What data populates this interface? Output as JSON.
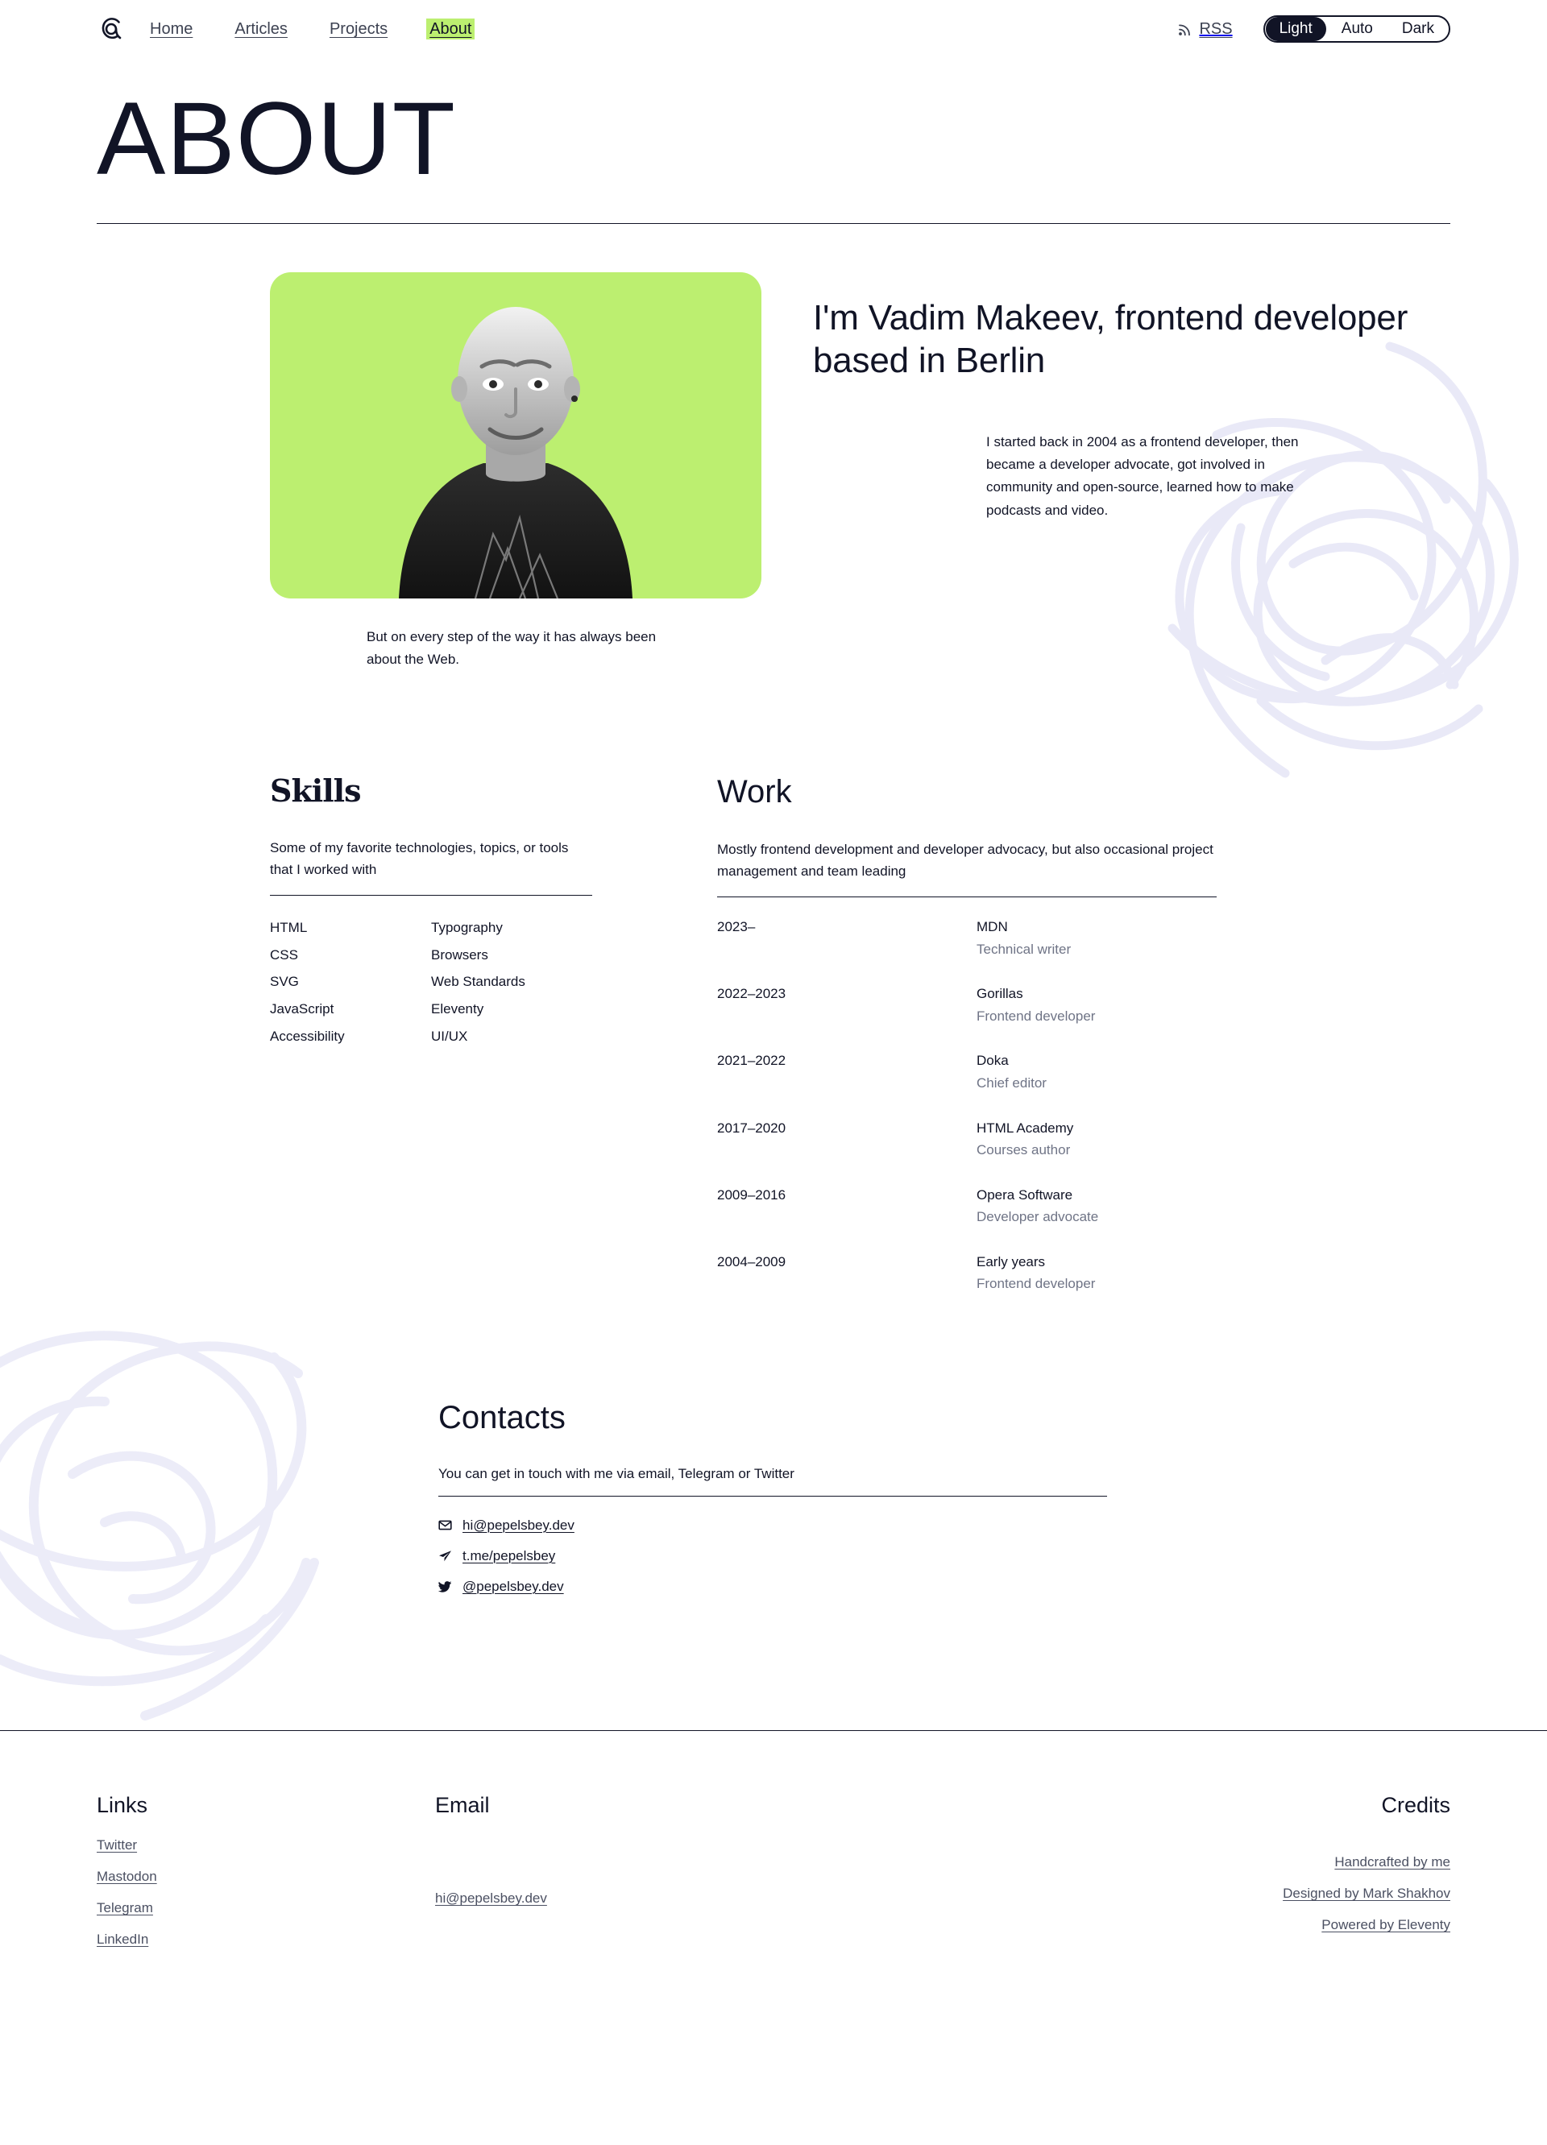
{
  "header": {
    "logo_name": "at-sign-logo",
    "nav": [
      {
        "label": "Home",
        "current": false
      },
      {
        "label": "Articles",
        "current": false
      },
      {
        "label": "Projects",
        "current": false
      },
      {
        "label": "About",
        "current": true
      }
    ],
    "rss_label": "RSS",
    "theme": {
      "options": [
        "Light",
        "Auto",
        "Dark"
      ],
      "selected": "Light"
    },
    "accent_color": "#bcef70",
    "ink_color": "#111426"
  },
  "page": {
    "title": "ABOUT"
  },
  "hero": {
    "heading": "I'm Vadim Makeev, frontend developer based in Berlin",
    "paragraph_1": "I started back in 2004 as a frontend developer, then became a developer advocate, got involved in community and open-source, learned how to make podcasts and video.",
    "paragraph_2": "But on every step of the way it has always been about the Web.",
    "card_color": "#bcef70",
    "portrait_name": "portrait-vadim-makeev"
  },
  "skills": {
    "title": "Skills",
    "subtitle": "Some of my favorite technologies, topics, or tools that I worked with",
    "column_1": [
      "HTML",
      "CSS",
      "SVG",
      "JavaScript",
      "Accessibility"
    ],
    "column_2": [
      "Typography",
      "Browsers",
      "Web Standards",
      "Eleventy",
      "UI/UX"
    ]
  },
  "work": {
    "title": "Work",
    "subtitle": "Mostly frontend development and developer advocacy, but also occasional project management and team leading",
    "entries": [
      {
        "years": "2023–",
        "org": "MDN",
        "role": "Technical writer"
      },
      {
        "years": "2022–2023",
        "org": "Gorillas",
        "role": "Frontend developer"
      },
      {
        "years": "2021–2022",
        "org": "Doka",
        "role": "Chief editor"
      },
      {
        "years": "2017–2020",
        "org": "HTML Academy",
        "role": "Courses author"
      },
      {
        "years": "2009–2016",
        "org": "Opera Software",
        "role": "Developer advocate"
      },
      {
        "years": "2004–2009",
        "org": "Early years",
        "role": "Frontend developer"
      }
    ]
  },
  "contacts": {
    "title": "Contacts",
    "subtitle": "You can get in touch with me via email, Telegram or Twitter",
    "items": [
      {
        "icon": "envelope-icon",
        "label": "hi@pepelsbey.dev"
      },
      {
        "icon": "telegram-icon",
        "label": "t.me/pepelsbey"
      },
      {
        "icon": "twitter-icon",
        "label": "@pepelsbey.dev"
      }
    ]
  },
  "footer": {
    "links": {
      "title": "Links",
      "items": [
        "Twitter",
        "Mastodon",
        "Telegram",
        "LinkedIn"
      ]
    },
    "email": {
      "title": "Email",
      "items": [
        "hi@pepelsbey.dev"
      ]
    },
    "credits": {
      "title": "Credits",
      "items": [
        "Handcrafted by me",
        "Designed by Mark Shakhov",
        "Powered by Eleventy"
      ]
    }
  }
}
